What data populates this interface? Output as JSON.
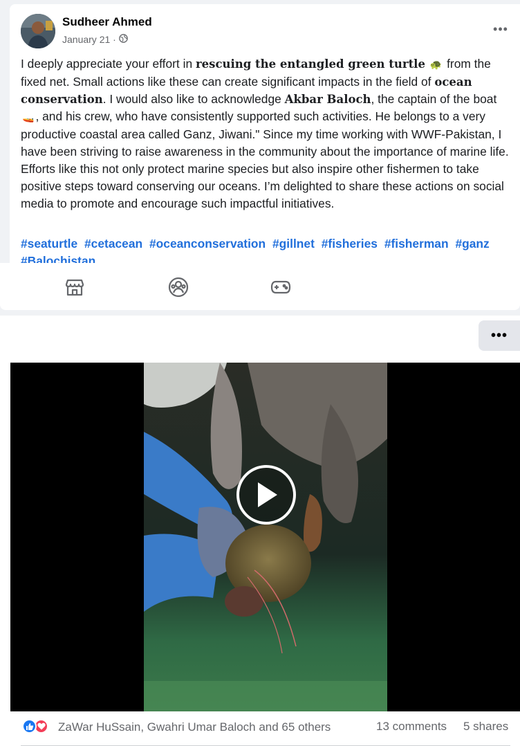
{
  "post": {
    "author": "Sudheer Ahmed",
    "date": "January 21 ·",
    "more_label": "•••",
    "text": {
      "p1": "I deeply appreciate your effort in ",
      "b1": "rescuing the entangled green turtle",
      "emoji_turtle": "🐢",
      "p2": " from the fixed net. Small actions like these can create significant impacts in the field of ",
      "b2": "ocean conservation",
      "p3": ". I would also like to acknowledge ",
      "b3": "Akbar Baloch",
      "p4": ", the captain of the boat ",
      "emoji_boat": "🚤",
      "p5": ", and his crew, who have consistently supported such activities. He belongs to a very productive coastal area called Ganz, Jiwani.\" Since my time working with WWF-Pakistan, I have been striving to raise awareness in the community about the importance of marine life. Efforts like this not only protect marine species but also inspire other fishermen to take positive steps toward conserving our oceans. I’m delighted to share these actions on social media to promote and encourage such impactful initiatives."
    },
    "hashtags": [
      "#seaturtle",
      "#cetacean",
      "#oceanconservation",
      "#gillnet",
      "#fisheries",
      "#fisherman",
      "#ganz",
      "#Balochistan"
    ]
  },
  "toolbar": {
    "icons": [
      "marketplace-icon",
      "groups-icon",
      "gaming-icon"
    ]
  },
  "second_post": {
    "more_label": "•••"
  },
  "footer": {
    "reaction_names": "ZaWar HuSsain, Gwahri Umar Baloch and 65 others",
    "comments": "13 comments",
    "shares": "5 shares"
  },
  "colors": {
    "link_blue": "#216fdb",
    "like_blue": "#1877f2",
    "love_red": "#f33e58",
    "secondary_text": "#65676b"
  }
}
